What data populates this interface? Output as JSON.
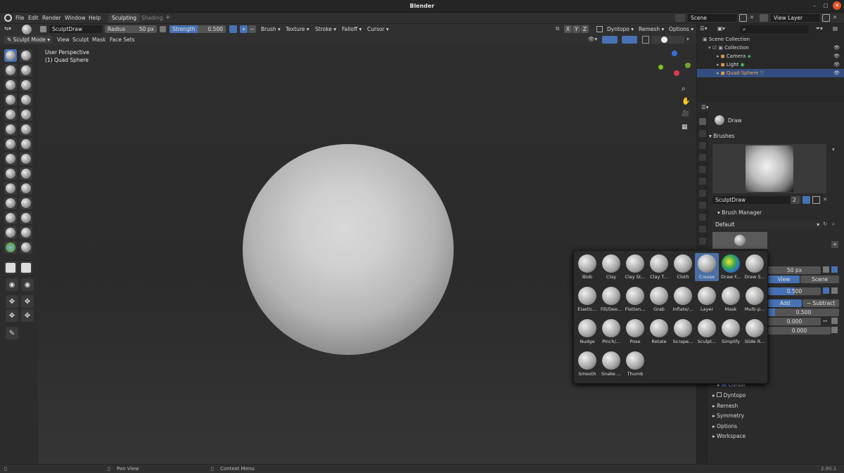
{
  "window": {
    "title": "Blender"
  },
  "menu": [
    "File",
    "Edit",
    "Render",
    "Window",
    "Help"
  ],
  "workspaces": [
    {
      "label": "Sculpting",
      "active": true
    },
    {
      "label": "Shading",
      "active": false
    }
  ],
  "scene": {
    "name": "Scene",
    "view_layer": "View Layer"
  },
  "header": {
    "brush_name": "SculptDraw",
    "radius_label": "Radius",
    "radius_value": "50 px",
    "strength_label": "Strength",
    "strength_value": "0.500",
    "menus": [
      "Brush",
      "Texture",
      "Stroke",
      "Falloff",
      "Cursor"
    ],
    "axes": [
      "X",
      "Y",
      "Z"
    ],
    "right_menus": [
      "Dyntopo",
      "Remesh",
      "Options"
    ]
  },
  "header2": {
    "mode": "Sculpt Mode",
    "menus": [
      "View",
      "Sculpt",
      "Mask",
      "Face Sets"
    ]
  },
  "viewport": {
    "perspective": "User Perspective",
    "object": "(1) Quad Sphere"
  },
  "outliner": {
    "rows": [
      {
        "label": "Scene Collection",
        "indent": 0
      },
      {
        "label": "Collection",
        "indent": 1
      },
      {
        "label": "Camera",
        "indent": 2
      },
      {
        "label": "Light",
        "indent": 2
      },
      {
        "label": "Quad Sphere",
        "indent": 2,
        "selected": true
      }
    ]
  },
  "properties": {
    "tool_name": "Draw",
    "brushes_header": "Brushes",
    "brush_datablock": "SculptDraw",
    "brush_users": "2",
    "brush_manager": "Brush Manager",
    "preset": "Default",
    "radius": "50 px",
    "view": "View",
    "scene": "Scene",
    "strength": "0.500",
    "add": "Add",
    "subtract": "Subtract",
    "autosmooth": "0.500",
    "normal_radius": "0.000",
    "hardness": "0.000",
    "cursor": "Cursor",
    "sections": [
      "Dyntopo",
      "Remesh",
      "Symmetry",
      "Options",
      "Workspace"
    ]
  },
  "picker": {
    "brushes": [
      "Blob",
      "Clay",
      "Clay St...",
      "Clay T...",
      "Cloth",
      "Crease",
      "Draw F...",
      "Draw S...",
      "Elastic...",
      "Fill/Dee...",
      "Flatten...",
      "Grab",
      "Inflate/...",
      "Layer",
      "Mask",
      "Multi-p...",
      "Nudge",
      "Pinch/...",
      "Pose",
      "Rotate",
      "Scrape...",
      "Sculpt...",
      "Simplify",
      "Slide R...",
      "Smooth",
      "Snake ...",
      "Thumb"
    ],
    "selected": "Crease"
  },
  "status": {
    "pan": "Pan View",
    "context": "Context Menu",
    "version": "2.90.1"
  },
  "colors": {
    "accent": "#4772b3",
    "selected_row": "#334d80"
  }
}
